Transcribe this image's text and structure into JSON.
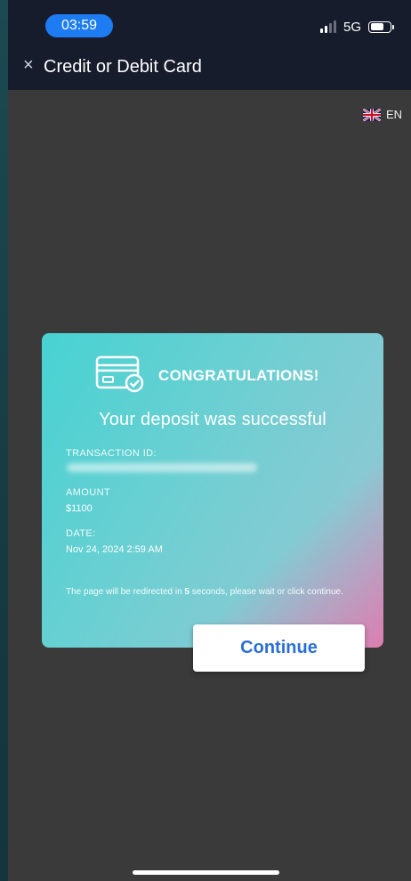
{
  "status_bar": {
    "time": "03:59",
    "network": "5G",
    "battery_level": 0.7
  },
  "header": {
    "title": "Credit or Debit Card",
    "close_glyph": "×"
  },
  "language": {
    "code": "EN",
    "flag_icon": "uk-flag-icon"
  },
  "card": {
    "heading": "CONGRATULATIONS!",
    "message": "Your deposit was successful",
    "transaction_id_label": "TRANSACTION ID:",
    "amount_label": "AMOUNT",
    "amount_value": "$1100",
    "date_label": "DATE:",
    "date_value": "Nov 24, 2024 2:59 AM",
    "notice_prefix": "The page will be redirected in ",
    "notice_seconds": "5",
    "notice_suffix": " seconds, please wait or click continue.",
    "icon": "credit-card-check-icon"
  },
  "actions": {
    "continue_label": "Continue"
  },
  "colors": {
    "header_bg": "#171c2c",
    "page_bg": "#3a3a3a",
    "card_teal": "#47d2d2",
    "card_pink": "#e870aa",
    "accent_blue": "#2a6fd6",
    "time_pill": "#1d7cf2"
  }
}
